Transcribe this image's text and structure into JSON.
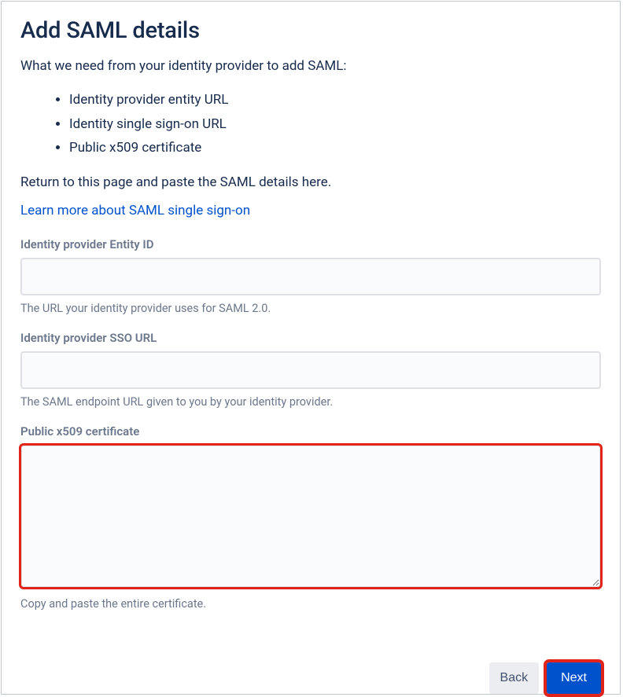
{
  "title": "Add SAML details",
  "intro": "What we need from your identity provider to add SAML:",
  "requirements": [
    "Identity provider entity URL",
    "Identity single sign-on URL",
    "Public x509 certificate"
  ],
  "returnText": "Return to this page and paste the SAML details here.",
  "learnMore": "Learn more about SAML single sign-on",
  "fields": {
    "entityId": {
      "label": "Identity provider Entity ID",
      "value": "",
      "help": "The URL your identity provider uses for SAML 2.0."
    },
    "ssoUrl": {
      "label": "Identity provider SSO URL",
      "value": "",
      "help": "The SAML endpoint URL given to you by your identity provider."
    },
    "certificate": {
      "label": "Public x509 certificate",
      "value": "",
      "help": "Copy and paste the entire certificate."
    }
  },
  "buttons": {
    "back": "Back",
    "next": "Next"
  }
}
